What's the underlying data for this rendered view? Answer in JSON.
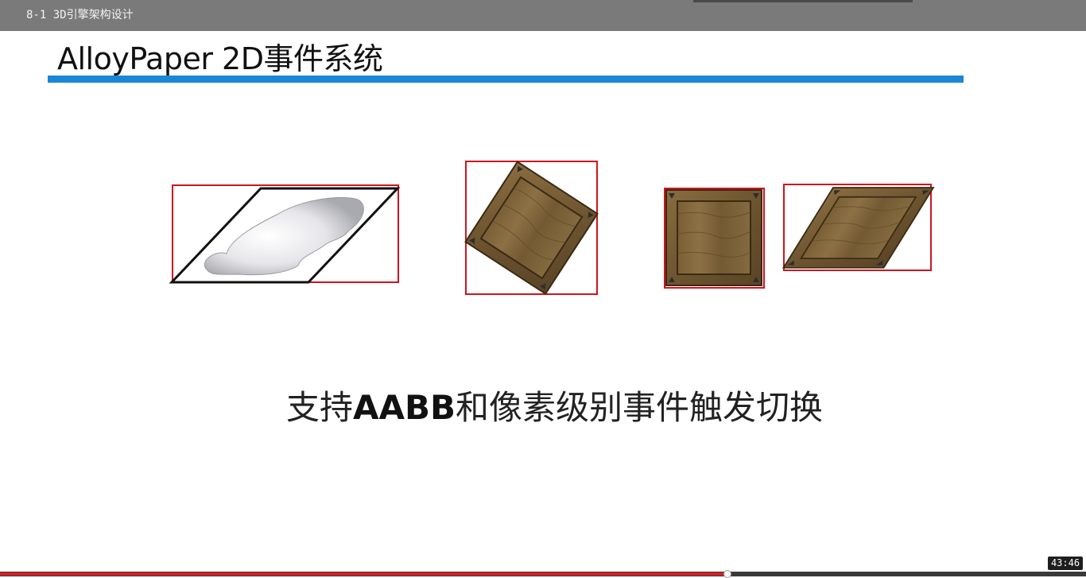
{
  "player": {
    "video_title": "8-1 3D引擎架构设计",
    "timestamp": "43:46",
    "progress": 0.67
  },
  "slide": {
    "title": "AlloyPaper 2D事件系统",
    "caption_prefix": "支持",
    "caption_strong": "AABB",
    "caption_suffix": "和像素级别事件触发切换"
  },
  "colors": {
    "accent_bar": "#1a86d6",
    "bbox_red": "#d0141e",
    "progress_red": "#d62020",
    "topbar": "#7a7a7a"
  },
  "figures": [
    {
      "name": "skewed-cloud-sprite",
      "icon": "cloud-image"
    },
    {
      "name": "rotated-crate-sprite",
      "icon": "wooden-crate"
    },
    {
      "name": "crate-sprite",
      "icon": "wooden-crate"
    },
    {
      "name": "skewed-crate-sprite",
      "icon": "wooden-crate"
    }
  ]
}
